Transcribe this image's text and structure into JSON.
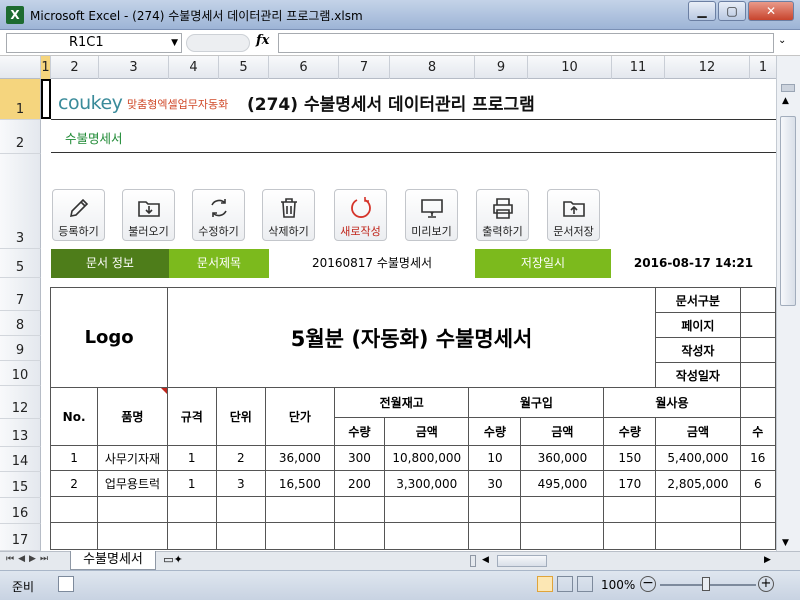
{
  "window": {
    "title": "Microsoft Excel - (274) 수불명세서 데이터관리 프로그램.xlsm",
    "app_icon": "excel-icon"
  },
  "formula_bar": {
    "name_box": "R1C1",
    "fx_label": "fx",
    "formula": ""
  },
  "columns": [
    "1",
    "2",
    "3",
    "4",
    "5",
    "6",
    "7",
    "8",
    "9",
    "10",
    "11",
    "12",
    "1"
  ],
  "rows": [
    "1",
    "2",
    "3",
    "5",
    "7",
    "8",
    "9",
    "10",
    "12",
    "13",
    "14",
    "15",
    "16",
    "17"
  ],
  "sheet": {
    "logo_text": "coukey",
    "logo_sub": "맞춤형엑셀업무자동화",
    "title": "(274) 수불명세서 데이터관리 프로그램",
    "subtitle": "수불명세서",
    "toolbar": [
      {
        "label": "등록하기",
        "icon": "pencil-icon"
      },
      {
        "label": "불러오기",
        "icon": "folder-download-icon"
      },
      {
        "label": "수정하기",
        "icon": "refresh-icon"
      },
      {
        "label": "삭제하기",
        "icon": "trash-icon"
      },
      {
        "label": "새로작성",
        "icon": "new-circle-icon"
      },
      {
        "label": "미리보기",
        "icon": "monitor-icon"
      },
      {
        "label": "출력하기",
        "icon": "printer-icon"
      },
      {
        "label": "문서저장",
        "icon": "folder-upload-icon"
      }
    ],
    "info": {
      "doc_info": "문서 정보",
      "doc_title_label": "문서제목",
      "doc_title": "20160817 수불명세서",
      "save_label": "저장일시",
      "save_date": "2016-08-17 14:21"
    },
    "header": {
      "logo": "Logo",
      "main_title": "5월분 (자동화) 수불명세서",
      "fields": [
        "문서구분",
        "페이지",
        "작성자",
        "작성일자"
      ]
    },
    "table": {
      "headers": {
        "no": "No.",
        "item": "품명",
        "spec": "규격",
        "unit": "단위",
        "price": "단가",
        "prev": "전월재고",
        "in": "월구입",
        "use": "월사용",
        "qty": "수량",
        "amt": "금액",
        "next_qty": "수"
      },
      "rows": [
        [
          "1",
          "사무기자재",
          "1",
          "2",
          "36,000",
          "300",
          "10,800,000",
          "10",
          "360,000",
          "150",
          "5,400,000",
          "16"
        ],
        [
          "2",
          "업무용트럭",
          "1",
          "3",
          "16,500",
          "200",
          "3,300,000",
          "30",
          "495,000",
          "170",
          "2,805,000",
          "6"
        ]
      ]
    }
  },
  "tabs": {
    "active": "수불명세서"
  },
  "status": {
    "ready": "준비",
    "zoom": "100%"
  },
  "colors": {
    "green_dark": "#4e7d1a",
    "green_light": "#7cba1d",
    "title_green": "#1f8a35"
  }
}
